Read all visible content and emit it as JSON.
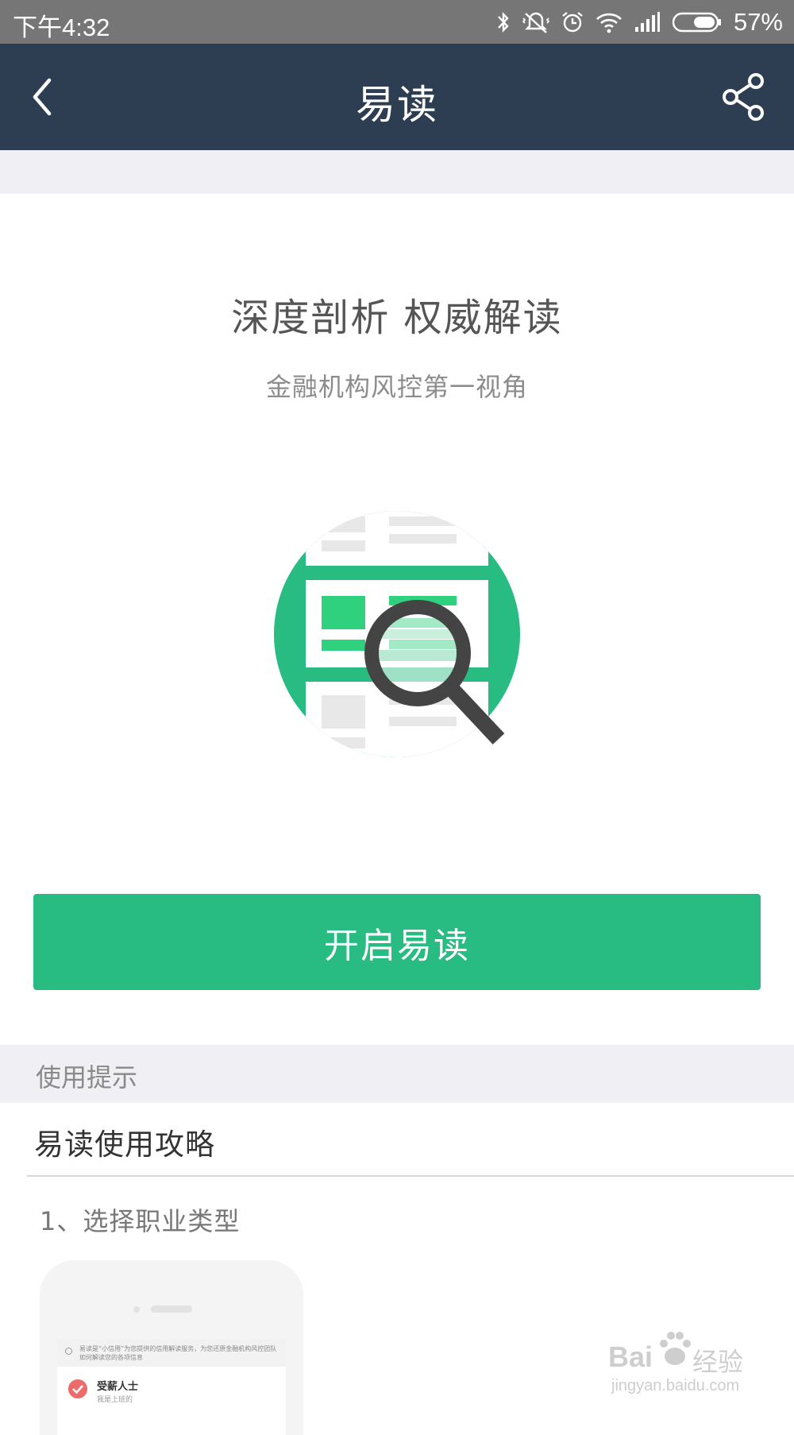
{
  "status_bar": {
    "time": "下午4:32",
    "battery": "57%",
    "icons": [
      "bluetooth-icon",
      "vibrate-icon",
      "alarm-icon",
      "wifi-icon",
      "signal-icon",
      "battery-icon"
    ]
  },
  "nav": {
    "title": "易读",
    "back_icon": "chevron-left-icon",
    "share_icon": "share-icon"
  },
  "hero": {
    "title": "深度剖析  权威解读",
    "subtitle": "金融机构风控第一视角"
  },
  "actions": {
    "start_label": "开启易读"
  },
  "tips": {
    "header": "使用提示",
    "guide_title": "易读使用攻略",
    "step_1": "1、选择职业类型"
  },
  "phone_preview": {
    "notice": "易读是“小信用”为您提供的信用解读服务，为您还原金融机构风控团队如何解读您的各项信息",
    "option_title": "受薪人士",
    "option_subtitle": "我是上班的"
  },
  "watermark": {
    "brand": "Bai",
    "brand_cn": "经验",
    "url": "jingyan.baidu.com"
  },
  "colors": {
    "nav_bg": "#2e3e52",
    "accent_green": "#28bc83",
    "status_bg": "#767676",
    "section_bg": "#efeff4"
  }
}
